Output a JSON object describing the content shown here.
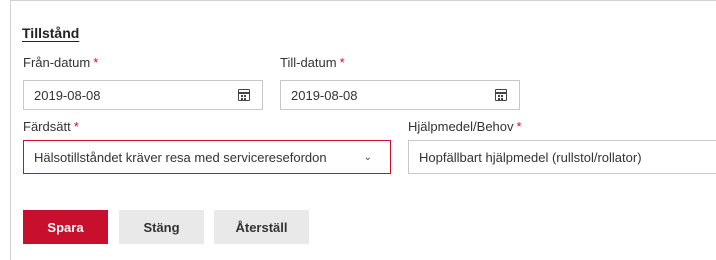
{
  "section": {
    "title": "Tillstånd"
  },
  "fields": {
    "from_date": {
      "label": "Från-datum",
      "required_mark": "*",
      "value": "2019-08-08",
      "icon": "calendar-icon"
    },
    "to_date": {
      "label": "Till-datum",
      "required_mark": "*",
      "value": "2019-08-08",
      "icon": "calendar-icon"
    },
    "travel_mode": {
      "label": "Färdsätt",
      "required_mark": "*",
      "value": "Hälsotillståndet kräver resa med serviceresefordon",
      "icon": "chevron-down-icon"
    },
    "aid_need": {
      "label": "Hjälpmedel/Behov",
      "required_mark": "*",
      "value": "Hopfällbart hjälpmedel (rullstol/rollator)"
    }
  },
  "buttons": {
    "save": "Spara",
    "close": "Stäng",
    "reset": "Återställ"
  },
  "colors": {
    "accent": "#c8102e",
    "secondary_button": "#e9e9e9",
    "border": "#c8c8c8"
  }
}
